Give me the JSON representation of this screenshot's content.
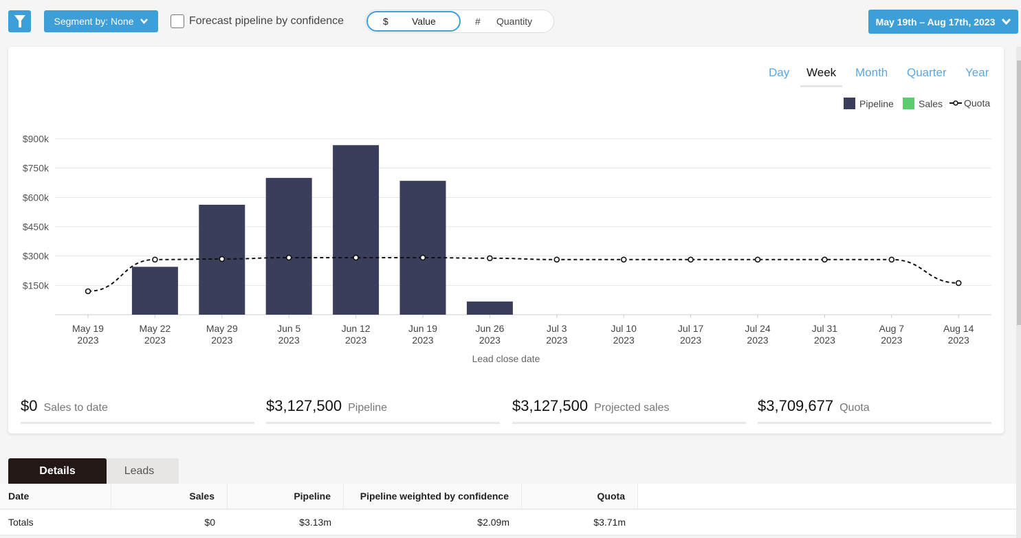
{
  "toolbar": {
    "filter_icon": "funnel-icon",
    "segment_label": "Segment by: None",
    "forecast_label": "Forecast pipeline by confidence",
    "forecast_checked": false,
    "toggle": {
      "value_symbol": "$",
      "value_label": "Value",
      "qty_symbol": "#",
      "qty_label": "Quantity",
      "selected": "Value"
    },
    "date_range": "May 19th – Aug 17th, 2023"
  },
  "granularity": {
    "options": [
      "Day",
      "Week",
      "Month",
      "Quarter",
      "Year"
    ],
    "selected": "Week"
  },
  "legend": {
    "pipeline": "Pipeline",
    "sales": "Sales",
    "quota": "Quota"
  },
  "colors": {
    "pipeline": "#3b3e5b",
    "sales": "#5ccc6e",
    "quota": "#111111",
    "accent": "#3d9ed8"
  },
  "chart_data": {
    "type": "bar",
    "xlabel": "Lead close date",
    "ylabel": "",
    "ylim": [
      0,
      900000
    ],
    "yticks": [
      "$150k",
      "$300k",
      "$450k",
      "$600k",
      "$750k",
      "$900k"
    ],
    "ytick_values": [
      150000,
      300000,
      450000,
      600000,
      750000,
      900000
    ],
    "grid": true,
    "legend_position": "top-right",
    "categories": [
      [
        "May 19",
        "2023"
      ],
      [
        "May 22",
        "2023"
      ],
      [
        "May 29",
        "2023"
      ],
      [
        "Jun 5",
        "2023"
      ],
      [
        "Jun 12",
        "2023"
      ],
      [
        "Jun 19",
        "2023"
      ],
      [
        "Jun 26",
        "2023"
      ],
      [
        "Jul 3",
        "2023"
      ],
      [
        "Jul 10",
        "2023"
      ],
      [
        "Jul 17",
        "2023"
      ],
      [
        "Jul 24",
        "2023"
      ],
      [
        "Jul 31",
        "2023"
      ],
      [
        "Aug 7",
        "2023"
      ],
      [
        "Aug 14",
        "2023"
      ]
    ],
    "series": [
      {
        "name": "Pipeline",
        "type": "bar",
        "values": [
          0,
          245000,
          562500,
          700000,
          867500,
          685000,
          67500,
          0,
          0,
          0,
          0,
          0,
          0,
          0
        ]
      },
      {
        "name": "Sales",
        "type": "bar",
        "values": [
          0,
          0,
          0,
          0,
          0,
          0,
          0,
          0,
          0,
          0,
          0,
          0,
          0,
          0
        ]
      },
      {
        "name": "Quota",
        "type": "line",
        "values": [
          120000,
          282000,
          285000,
          292000,
          292000,
          292000,
          289000,
          282000,
          282000,
          282000,
          282000,
          282000,
          282000,
          162000
        ]
      }
    ]
  },
  "stats": [
    {
      "value": "$0",
      "label": "Sales to date"
    },
    {
      "value": "$3,127,500",
      "label": "Pipeline"
    },
    {
      "value": "$3,127,500",
      "label": "Projected sales"
    },
    {
      "value": "$3,709,677",
      "label": "Quota"
    }
  ],
  "tabs": [
    "Details",
    "Leads"
  ],
  "table": {
    "headers": [
      "Date",
      "Sales",
      "Pipeline",
      "Pipeline weighted by confidence",
      "Quota"
    ],
    "rows": [
      [
        "Totals",
        "$0",
        "$3.13m",
        "$2.09m",
        "$3.71m"
      ]
    ]
  }
}
